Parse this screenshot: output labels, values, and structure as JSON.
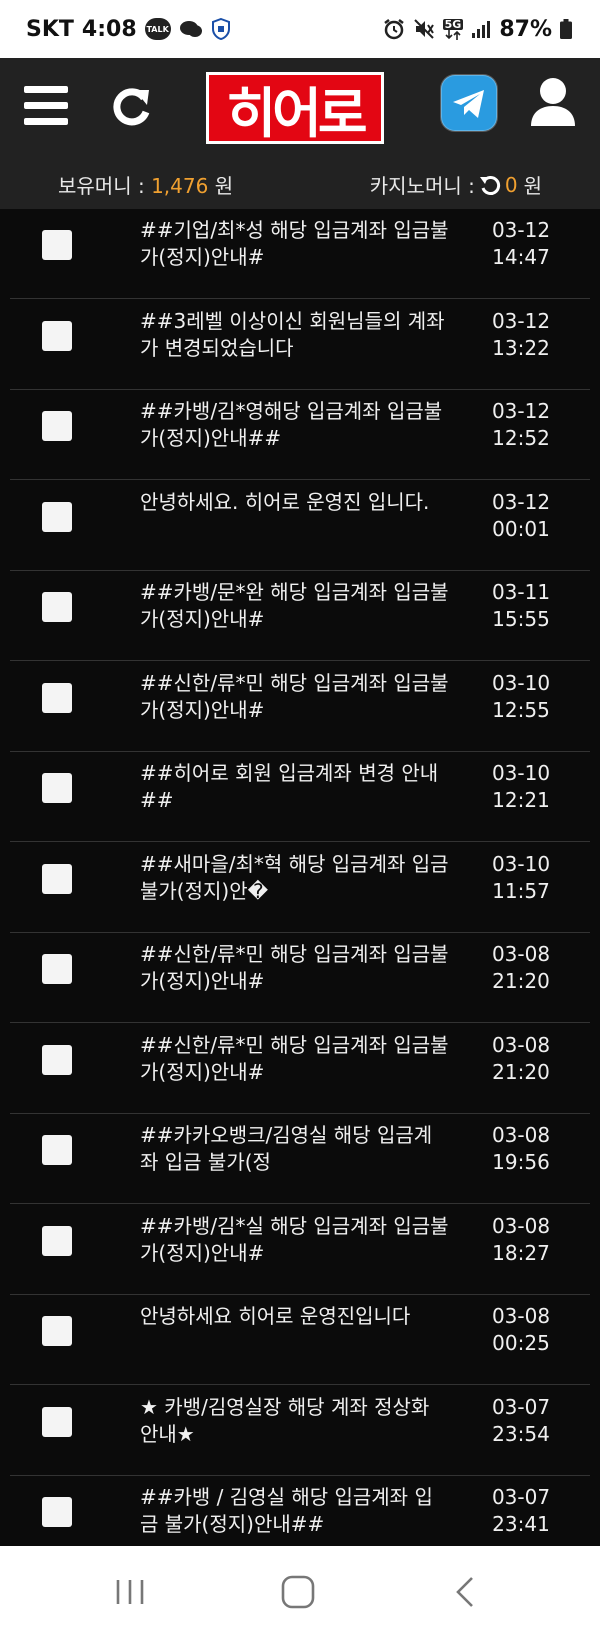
{
  "statusbar": {
    "carrier": "SKT",
    "time": "4:08",
    "talk_badge": "TALK",
    "network": "5G",
    "battery": "87%"
  },
  "header": {
    "logo_text": "히어로",
    "icons": [
      "menu-icon",
      "refresh-icon",
      "telegram-icon",
      "user-icon"
    ]
  },
  "money": {
    "hold_label": "보유머니 :",
    "hold_value": "1,476",
    "hold_unit": "원",
    "casino_label": "카지노머니 :",
    "casino_value": "0",
    "casino_unit": "원",
    "value_color": "#f0a030"
  },
  "rows": [
    {
      "title": "##기업/최*성 해당 입금계좌 입금불가(정지)안내#",
      "date": "03-12",
      "time": "14:47"
    },
    {
      "title": "##3레벨 이상이신 회원님들의 계좌가 변경되었습니다",
      "date": "03-12",
      "time": "13:22"
    },
    {
      "title": "##카뱅/김*영해당 입금계좌 입금불가(정지)안내##",
      "date": "03-12",
      "time": "12:52"
    },
    {
      "title": "안녕하세요. 히어로 운영진 입니다.",
      "date": "03-12",
      "time": "00:01"
    },
    {
      "title": "##카뱅/문*완 해당 입금계좌 입금불가(정지)안내#",
      "date": "03-11",
      "time": "15:55"
    },
    {
      "title": "##신한/류*민 해당 입금계좌 입금불가(정지)안내#",
      "date": "03-10",
      "time": "12:55"
    },
    {
      "title": "##히어로 회원 입금계좌 변경 안내##",
      "date": "03-10",
      "time": "12:21"
    },
    {
      "title": "##새마을/최*혁 해당 입금계좌 입금 불가(정지)안�",
      "date": "03-10",
      "time": "11:57"
    },
    {
      "title": "##신한/류*민 해당 입금계좌 입금불가(정지)안내#",
      "date": "03-08",
      "time": "21:20"
    },
    {
      "title": "##신한/류*민 해당 입금계좌 입금불가(정지)안내#",
      "date": "03-08",
      "time": "21:20"
    },
    {
      "title": "##카카오뱅크/김영실 해당 입금계좌 입금 불가(정",
      "date": "03-08",
      "time": "19:56"
    },
    {
      "title": "##카뱅/김*실 해당 입금계좌 입금불가(정지)안내#",
      "date": "03-08",
      "time": "18:27"
    },
    {
      "title": "안녕하세요 히어로 운영진입니다",
      "date": "03-08",
      "time": "00:25"
    },
    {
      "title": "★ 카뱅/김영실장 해당 계좌 정상화 안내★",
      "date": "03-07",
      "time": "23:54"
    },
    {
      "title": "##카뱅 / 김영실 해당 입금계좌 입금 불가(정지)안내##",
      "date": "03-07",
      "time": "23:41"
    }
  ],
  "navbar": {
    "icons": [
      "recent-apps-icon",
      "home-icon",
      "back-icon"
    ]
  }
}
